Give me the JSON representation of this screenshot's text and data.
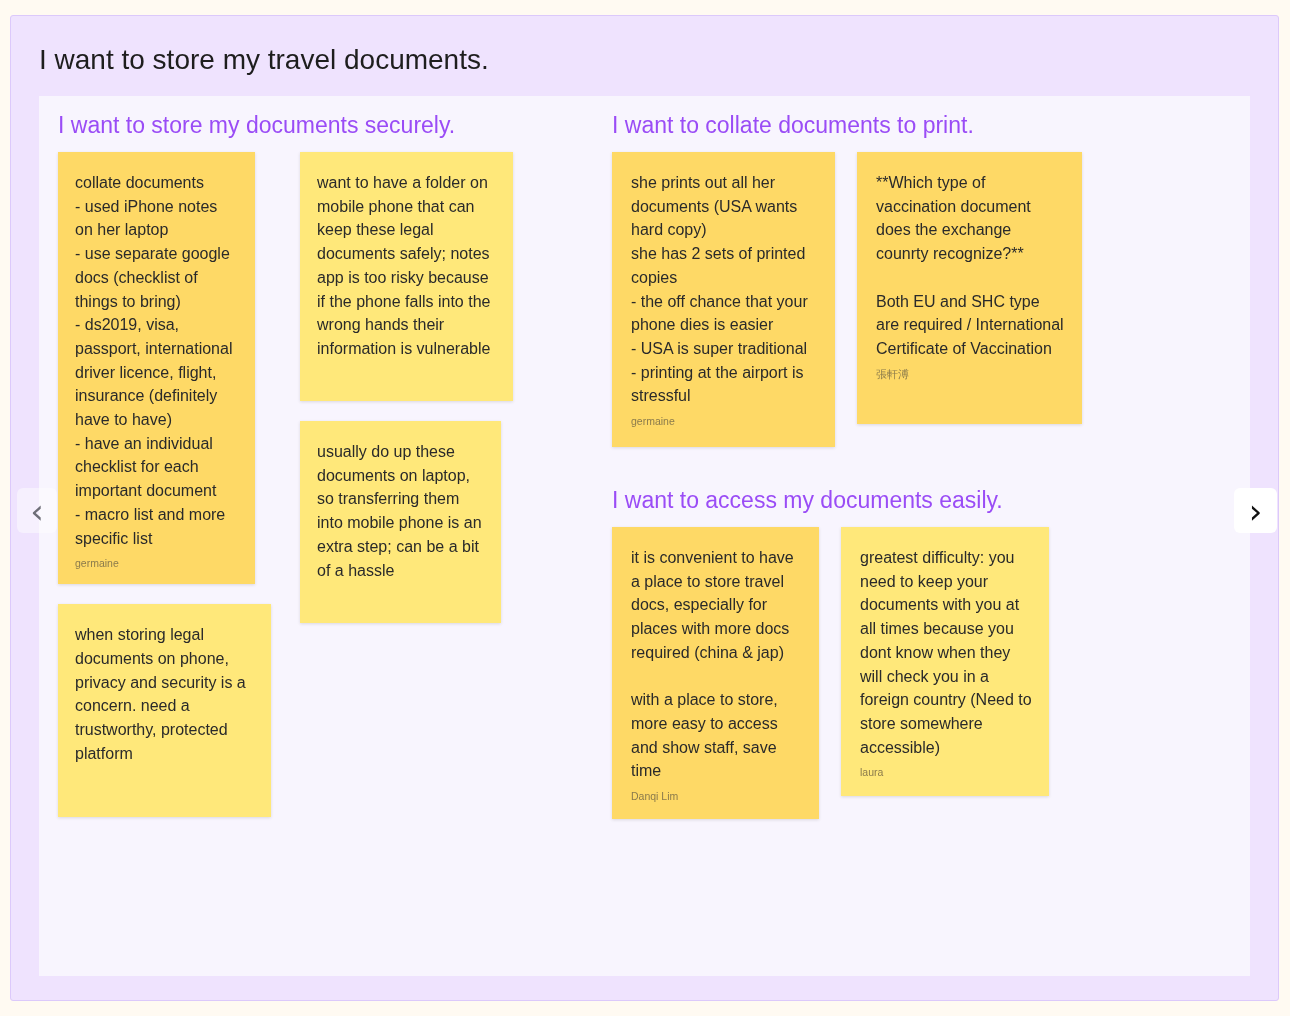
{
  "title": "I want to store my travel documents.",
  "nav": {
    "previous": {
      "icon": "‹",
      "disabled": true
    },
    "next": {
      "icon": "›",
      "disabled": false
    }
  },
  "sections": [
    {
      "heading": "I want to store my documents securely.",
      "notes": [
        {
          "text": "collate documents\n- used iPhone notes on her laptop\n- use separate google docs (checklist of things to bring)\n- ds2019, visa, passport, international driver licence, flight, insurance (definitely have to have)\n- have an individual checklist for each important document\n- macro list and more specific list",
          "author": "germaine",
          "color": "#fed966"
        },
        {
          "text": "when storing legal documents on phone, privacy and security is a concern. need a trustworthy, protected platform",
          "color": "#ffe87a"
        },
        {
          "text": "want to have a folder on mobile phone that can keep these legal documents safely; notes app is too risky because if the phone falls into the wrong hands their information is vulnerable",
          "color": "#ffe87a"
        },
        {
          "text": "usually do up these documents on laptop, so transferring them into mobile phone is an extra step; can be a bit of a hassle",
          "color": "#ffe87a"
        }
      ]
    },
    {
      "heading": "I want to collate documents to print.",
      "notes": [
        {
          "text": "she prints out all her documents (USA wants hard copy)\nshe has 2 sets of printed copies\n- the off chance that your phone dies is easier\n- USA is super traditional\n- printing at the airport is stressful",
          "author": "germaine",
          "color": "#fed966"
        },
        {
          "text": "**Which type of vaccination document does the exchange counrty recognize?**\n\nBoth EU and SHC type are required / International Certificate of Vaccination",
          "author": "張軒溥",
          "color": "#fed966"
        }
      ]
    },
    {
      "heading": "I want to access my documents easily.",
      "notes": [
        {
          "text": "it is convenient to have a place to store travel docs, especially for places with more docs required (china & jap)\n\nwith a place to store, more easy to access and show staff, save time",
          "author": "Danqi Lim",
          "color": "#fed966"
        },
        {
          "text": "greatest difficulty: you need to keep your documents with you at all times because you dont know when they will check you in a foreign country (Need to store somewhere accessible)",
          "author": "laura",
          "color": "#ffe87a"
        }
      ]
    }
  ]
}
